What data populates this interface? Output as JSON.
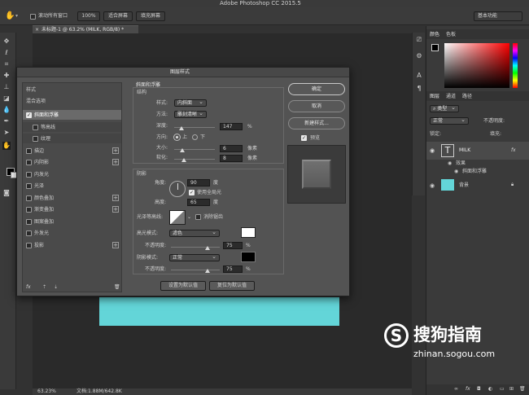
{
  "app": {
    "title": "Adobe Photoshop CC 2015.5"
  },
  "options_bar": {
    "scroll_all_label": "滚动所有窗口",
    "zoom_button": "100%",
    "fit_screen": "适合屏幕",
    "fill_screen": "填充屏幕",
    "workspace": "基本功能"
  },
  "document_tab": {
    "label": "未标题-1 @ 63.2% (MILK, RGB/8) *"
  },
  "status_bar": {
    "zoom": "63.23%",
    "doc_info": "文档:1.88M/642.8K"
  },
  "canvas": {
    "fill_color": "#63d5d8"
  },
  "right_panels": {
    "color_tabs": [
      "颜色",
      "色板"
    ],
    "layer_tabs": [
      "图层",
      "通道",
      "路径"
    ],
    "kind_filter": "类型",
    "blend_mode": "正常",
    "opacity_label": "不透明度:",
    "lock_label": "锁定:",
    "fill_label": "填充:",
    "layers": [
      {
        "name": "MILK",
        "type": "text"
      },
      {
        "name": "效果",
        "type": "effects"
      },
      {
        "name": "斜面和浮雕",
        "type": "effect"
      },
      {
        "name": "背景",
        "type": "background"
      }
    ]
  },
  "dialog": {
    "title": "图层样式",
    "left_list": {
      "styles": "样式",
      "blend_options": "混合选项",
      "items": [
        {
          "label": "斜面和浮雕",
          "checked": true,
          "selected": true,
          "plus": false,
          "indent": false
        },
        {
          "label": "等高线",
          "checked": false,
          "selected": false,
          "plus": false,
          "indent": true
        },
        {
          "label": "纹理",
          "checked": false,
          "selected": false,
          "plus": false,
          "indent": true
        },
        {
          "label": "描边",
          "checked": false,
          "selected": false,
          "plus": true,
          "indent": false
        },
        {
          "label": "内阴影",
          "checked": false,
          "selected": false,
          "plus": true,
          "indent": false
        },
        {
          "label": "内发光",
          "checked": false,
          "selected": false,
          "plus": false,
          "indent": false
        },
        {
          "label": "光泽",
          "checked": false,
          "selected": false,
          "plus": false,
          "indent": false
        },
        {
          "label": "颜色叠加",
          "checked": false,
          "selected": false,
          "plus": true,
          "indent": false
        },
        {
          "label": "渐变叠加",
          "checked": false,
          "selected": false,
          "plus": true,
          "indent": false
        },
        {
          "label": "图案叠加",
          "checked": false,
          "selected": false,
          "plus": false,
          "indent": false
        },
        {
          "label": "外发光",
          "checked": false,
          "selected": false,
          "plus": false,
          "indent": false
        },
        {
          "label": "投影",
          "checked": false,
          "selected": false,
          "plus": true,
          "indent": false
        }
      ],
      "fx_label": "fx"
    },
    "bevel": {
      "heading": "斜面和浮雕",
      "structure": "结构",
      "style_label": "样式:",
      "style_value": "内斜面",
      "technique_label": "方法:",
      "technique_value": "雕刻清晰",
      "depth_label": "深度:",
      "depth_value": "147",
      "depth_unit": "%",
      "depth_fraction": 0.15,
      "direction_label": "方向:",
      "dir_up": "上",
      "dir_down": "下",
      "size_label": "大小:",
      "size_value": "6",
      "size_unit": "像素",
      "size_fraction": 0.2,
      "soften_label": "软化:",
      "soften_value": "8",
      "soften_unit": "像素",
      "soften_fraction": 0.25
    },
    "shading": {
      "heading": "阴影",
      "angle_label": "角度:",
      "angle_value": "90",
      "angle_unit": "度",
      "global_light": "使用全局光",
      "altitude_label": "高度:",
      "altitude_value": "65",
      "altitude_unit": "度",
      "gloss_contour_label": "光泽等高线:",
      "anti_alias": "消除锯齿",
      "highlight_mode_label": "高光模式:",
      "highlight_mode": "滤色",
      "highlight_color": "#ffffff",
      "highlight_opacity_label": "不透明度:",
      "highlight_opacity": "75",
      "highlight_opacity_fraction": 0.75,
      "shadow_mode_label": "阴影模式:",
      "shadow_mode": "正常",
      "shadow_color": "#000000",
      "shadow_opacity_label": "不透明度:",
      "shadow_opacity": "75",
      "shadow_opacity_fraction": 0.75,
      "percent": "%"
    },
    "buttons": {
      "ok": "确定",
      "cancel": "取消",
      "new_style": "新建样式...",
      "preview": "预览",
      "make_default": "设置为默认值",
      "reset_default": "复位为默认值"
    }
  },
  "watermark": {
    "brand": "搜狗指南",
    "url": "zhinan.sogou.com"
  }
}
